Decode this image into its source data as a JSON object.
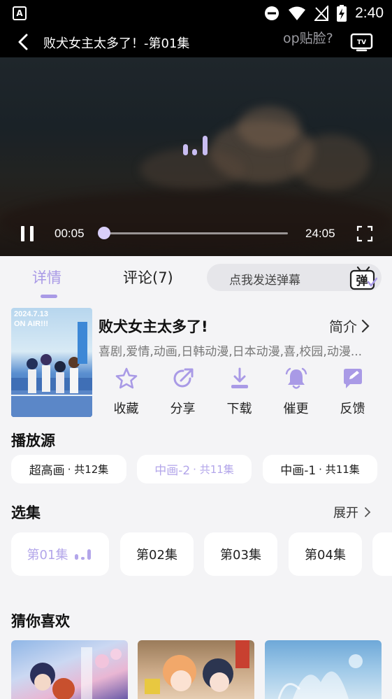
{
  "status_bar": {
    "time": "2:40",
    "left_icon": "A"
  },
  "player": {
    "title": "败犬女主太多了！-第01集",
    "overlay_text": "op贴脸?",
    "current_time": "00:05",
    "total_time": "24:05",
    "progress": 0.003
  },
  "tabs": {
    "detail": "详情",
    "comments": "评论(7)",
    "danmaku_placeholder": "点我发送弹幕",
    "danmaku_icon_char": "弹"
  },
  "info": {
    "poster_text_line1": "2024.7.13",
    "poster_text_line2": "ON AIR!!!",
    "title": "败犬女主太多了!",
    "intro_label": "简介",
    "tags": "喜剧,爱情,动画,日韩动漫,日本动漫,喜,校园,动漫..."
  },
  "actions": [
    {
      "label": "收藏",
      "icon": "star-icon"
    },
    {
      "label": "分享",
      "icon": "share-icon"
    },
    {
      "label": "下载",
      "icon": "download-icon"
    },
    {
      "label": "催更",
      "icon": "bell-icon"
    },
    {
      "label": "反馈",
      "icon": "feedback-icon"
    }
  ],
  "sources": {
    "title": "播放源",
    "items": [
      {
        "name": "超高画",
        "count": "· 共12集"
      },
      {
        "name": "中画-2",
        "count": "· 共11集"
      },
      {
        "name": "中画-1",
        "count": "· 共11集"
      }
    ]
  },
  "episodes": {
    "title": "选集",
    "expand_label": "展开",
    "items": [
      "第01集",
      "第02集",
      "第03集",
      "第04集"
    ]
  },
  "recommendations": {
    "title": "猜你喜欢"
  },
  "colors": {
    "accent": "#a99ae6",
    "background": "#f4f4f6"
  }
}
